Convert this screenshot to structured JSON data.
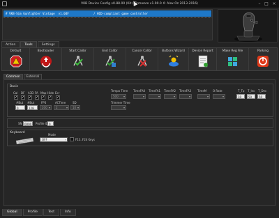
{
  "window": {
    "title": "VKB Device Config v0.88.00 (Kit / Firmware v1.90.0 © Alex Oz 2013-2016)",
    "minimize_glyph": "–",
    "maximize_glyph": "□",
    "close_glyph": "×"
  },
  "device_list": {
    "rows": [
      "# VKB-Sim Gunfighter Vintage  v1.04F              / HID-compliant game controller"
    ]
  },
  "main_tabs": [
    "Action",
    "Tools",
    "Settings"
  ],
  "main_tabs_active": 1,
  "toolbar": {
    "items": [
      {
        "label": "Default",
        "icon": "stop-warning-icon"
      },
      {
        "label": "Bootloader",
        "icon": "recycle-icon"
      },
      {
        "label": "Start Calibr",
        "icon": "calibrate-start-icon"
      },
      {
        "label": "End Calibr",
        "icon": "calibrate-end-icon"
      },
      {
        "label": "Cancel Calibr",
        "icon": "calibrate-cancel-icon"
      },
      {
        "label": "Buttons Wizard",
        "icon": "wizard-icon"
      },
      {
        "label": "Device Report",
        "icon": "report-icon"
      },
      {
        "label": "Make Reg File",
        "icon": "registry-icon"
      },
      {
        "label": "Parking",
        "icon": "parking-icon"
      }
    ]
  },
  "sub_tabs": [
    "Common",
    "External"
  ],
  "sub_tabs_active": 0,
  "basic": {
    "caption": "Basic",
    "flags": [
      {
        "label": "Cal",
        "checked": true
      },
      {
        "label": "DF",
        "checked": true
      },
      {
        "label": "A3D",
        "checked": true
      },
      {
        "label": "FA",
        "checked": true
      },
      {
        "label": "Map",
        "checked": true
      },
      {
        "label": "Hide",
        "checked": true
      },
      {
        "label": "Ecr",
        "checked": true
      }
    ],
    "nbut_label": "#But",
    "nbut_value": "0",
    "nbut2_label": "#But",
    "nbut2_value": "128",
    "fps_label": "FPS",
    "fps_value": "200",
    "actime_label": "ACTime",
    "actime_value": "2",
    "sd_label": "SD",
    "sd_value": "10",
    "tempo_label": "Tempo Time",
    "tempo_value": "500",
    "timer0_label": "TimeFA0",
    "timer0_value": "",
    "timer1_label": "TimeFA1",
    "timer1_value": "",
    "timer2_label": "TimeFA2",
    "timer2_value": "",
    "timer3_label": "TimeFA3",
    "timer3_value": "",
    "timerm_label": "TimeM",
    "timerm_value": "",
    "orate_label": "O Rate",
    "orate_value": "",
    "trimmer_label": "Trimmer Time",
    "trimmer_value": "",
    "ttp_label": "T_Tp",
    "ttp_value": "10",
    "tinc_label": "T_Inc",
    "tinc_value": "50",
    "tdec_label": "T_Dec",
    "tdec_value": "50"
  },
  "sn": {
    "label": "SN",
    "value": "0000",
    "profile_label": "Profile ID",
    "profile_value": "0"
  },
  "keyboard": {
    "caption": "Keyboard",
    "mode_label": "Mode",
    "mode_value": "OFF",
    "f13_label": "F13..F24 Keys",
    "f13_checked": false
  },
  "bottom_tabs": [
    "Global",
    "Profile",
    "Test",
    "Info"
  ],
  "bottom_tabs_active": 0,
  "colors": {
    "selection": "#1e78c8",
    "background": "#232323"
  }
}
